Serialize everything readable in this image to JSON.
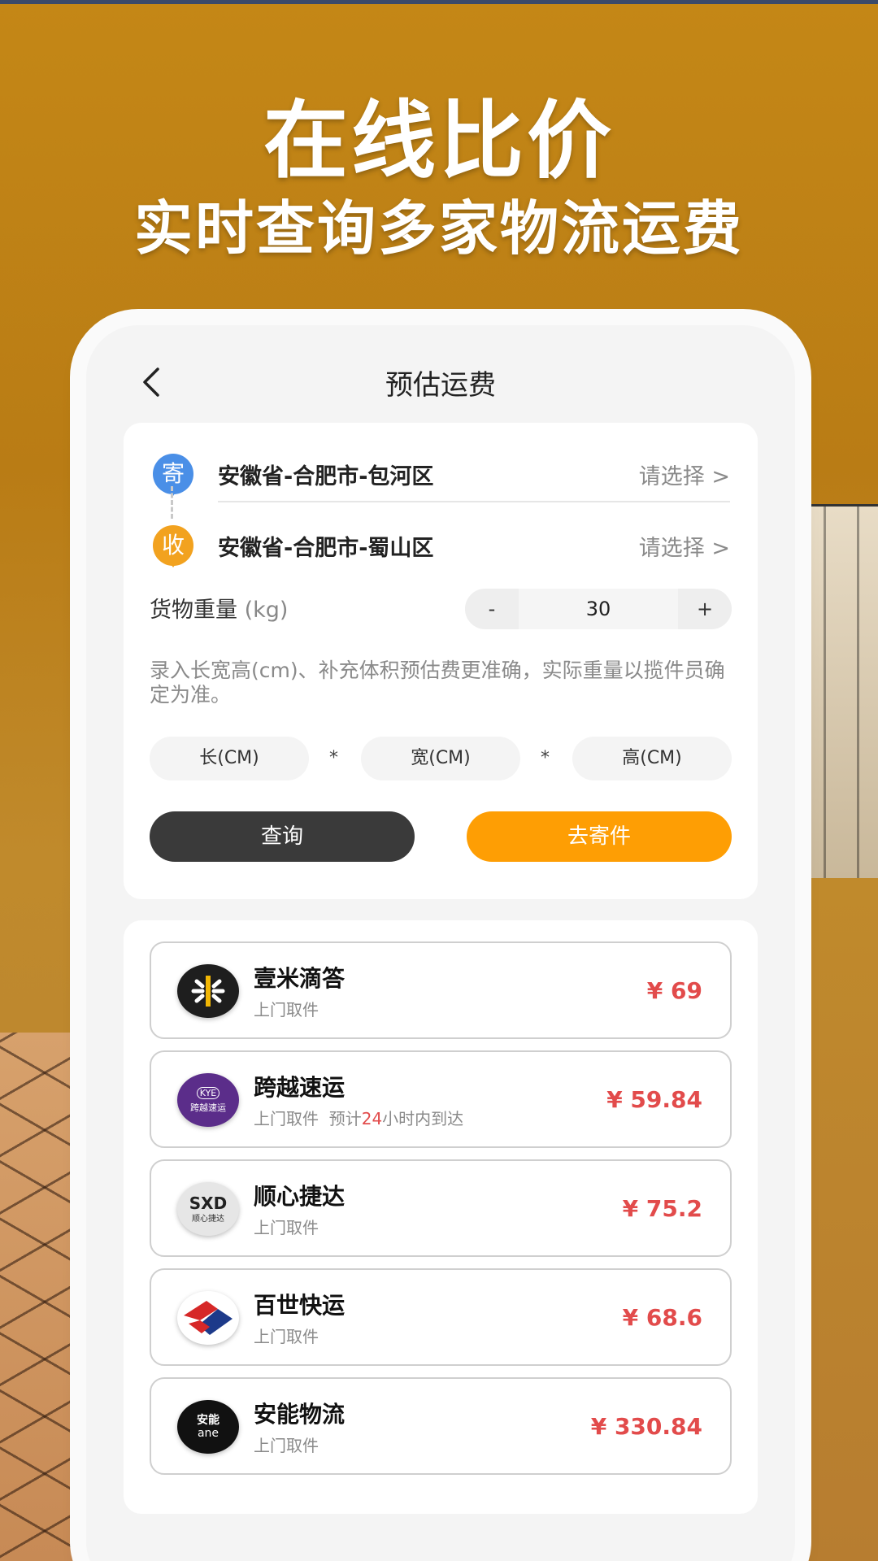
{
  "banner": {
    "title": "在线比价",
    "subtitle": "实时查询多家物流运费"
  },
  "nav": {
    "title": "预估运费"
  },
  "route": {
    "send_badge": "寄",
    "send_address": "安徽省-合肥市-包河区",
    "send_pick": "请选择 >",
    "recv_badge": "收",
    "recv_address": "安徽省-合肥市-蜀山区",
    "recv_pick": "请选择 >"
  },
  "weight": {
    "label": "货物重量",
    "unit": "(kg)",
    "minus": "-",
    "value": "30",
    "plus": "+"
  },
  "hint": "录入长宽高(cm)、补充体积预估费更准确，实际重量以揽件员确定为准。",
  "dimensions": {
    "length": "长(CM)",
    "width": "宽(CM)",
    "height": "高(CM)",
    "sep": "*"
  },
  "actions": {
    "query": "查询",
    "send": "去寄件"
  },
  "carriers": [
    {
      "name": "壹米滴答",
      "sub": "上门取件",
      "price": "¥ 69"
    },
    {
      "name": "跨越速运",
      "sub": "上门取件  预计",
      "sub_hl": "24",
      "sub_tail": "小时内到达",
      "price": "¥ 59.84"
    },
    {
      "name": "顺心捷达",
      "sub": "上门取件",
      "price": "¥ 75.2"
    },
    {
      "name": "百世快运",
      "sub": "上门取件",
      "price": "¥ 68.6"
    },
    {
      "name": "安能物流",
      "sub": "上门取件",
      "price": "¥ 330.84"
    }
  ],
  "logos": {
    "kye_top": "KYE",
    "kye_bottom": "跨越速运",
    "sxd_top": "SXD",
    "sxd_bottom": "顺心捷达",
    "ane_top": "安能",
    "ane_bottom": "ane"
  },
  "colors": {
    "accent": "#fe9e04",
    "price": "#e24b4b",
    "send_pin": "#4a8fe7",
    "recv_pin": "#f2a21f"
  }
}
